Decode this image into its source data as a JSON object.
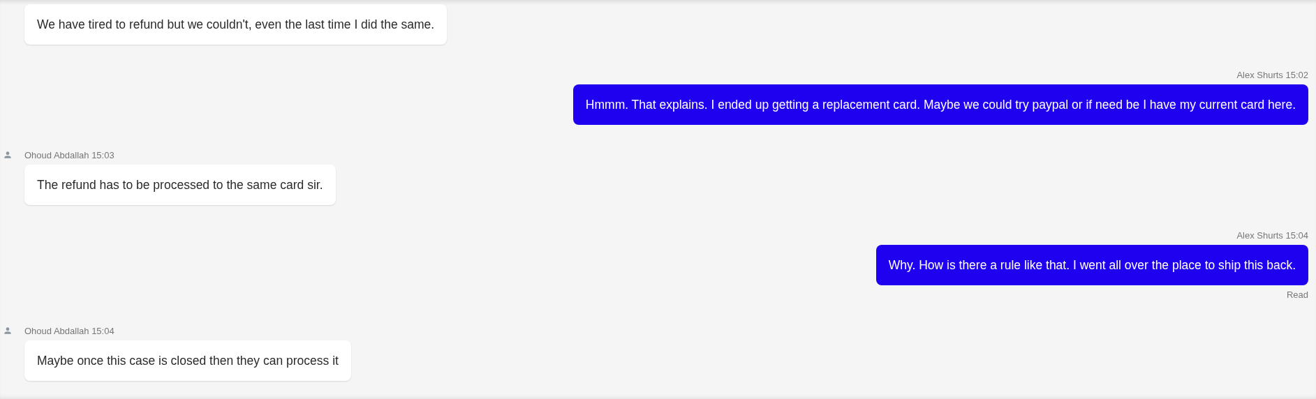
{
  "messages": [
    {
      "kind": "agent",
      "text": "We have tired to refund but we couldn't, even the last time I did the same."
    },
    {
      "kind": "customer",
      "sender": "Alex Shurts",
      "time": "15:02",
      "text": "Hmmm. That explains. I ended up getting a replacement card. Maybe we could try paypal or if need be I have my current card here."
    },
    {
      "kind": "agent",
      "sender": "Ohoud Abdallah",
      "time": "15:03",
      "text": "The refund has to be processed to the same card sir."
    },
    {
      "kind": "customer",
      "sender": "Alex Shurts",
      "time": "15:04",
      "text": "Why. How is there a rule like that. I went all over the place to ship this back.",
      "status": "Read"
    },
    {
      "kind": "agent",
      "sender": "Ohoud Abdallah",
      "time": "15:04",
      "text": "Maybe once this case is closed then they can process it"
    }
  ]
}
